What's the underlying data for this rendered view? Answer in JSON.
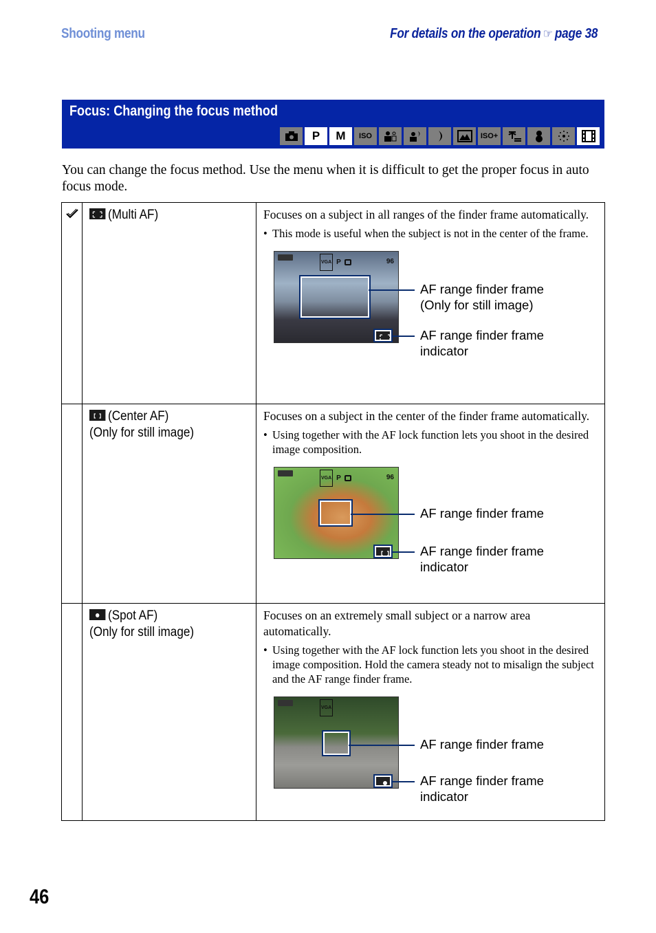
{
  "running_head": {
    "section": "Shooting menu",
    "details_prefix": "For details on the operation",
    "details_icon": "pointing-hand-icon",
    "details_page": "page 38"
  },
  "title_bar": {
    "title": "Focus: Changing the focus method",
    "mode_icons": [
      {
        "name": "auto-camera-icon",
        "label": "",
        "active": false
      },
      {
        "name": "program-mode-icon",
        "label": "P",
        "active": true
      },
      {
        "name": "manual-mode-icon",
        "label": "M",
        "active": true
      },
      {
        "name": "high-sensitivity-icon",
        "label": "ISO",
        "active": false
      },
      {
        "name": "soft-snap-icon",
        "label": "",
        "active": false
      },
      {
        "name": "twilight-portrait-icon",
        "label": "",
        "active": false
      },
      {
        "name": "twilight-icon",
        "label": "",
        "active": false
      },
      {
        "name": "landscape-icon",
        "label": "",
        "active": false
      },
      {
        "name": "high-speed-shutter-iso-plus-icon",
        "label": "ISO+",
        "active": false
      },
      {
        "name": "beach-icon",
        "label": "",
        "active": false
      },
      {
        "name": "snow-icon",
        "label": "",
        "active": false
      },
      {
        "name": "fireworks-icon",
        "label": "",
        "active": false
      },
      {
        "name": "movie-icon",
        "label": "",
        "active": true
      }
    ]
  },
  "intro": "You can change the focus method. Use the menu when it is difficult to get the proper focus in auto focus mode.",
  "rows": [
    {
      "default": true,
      "icon": "multi-af-icon",
      "name": "(Multi AF)",
      "name_note": "",
      "description": "Focuses on a subject in all ranges of the finder frame automatically.",
      "bullet": "This mode is useful when the subject is not in the center of the frame.",
      "image": {
        "scene": "business-people",
        "osd_number": "96",
        "osd_mode": "P",
        "callout_frame": "AF range finder frame",
        "callout_frame_note": "(Only for still image)",
        "callout_indicator": "AF range finder frame indicator"
      }
    },
    {
      "default": false,
      "icon": "center-af-icon",
      "name": "(Center AF)",
      "name_note": "(Only for still image)",
      "description": "Focuses on a subject in the center of the finder frame automatically.",
      "bullet": "Using together with the AF lock function lets you shoot in the desired image composition.",
      "image": {
        "scene": "dog-closeup",
        "osd_number": "96",
        "osd_mode": "P",
        "callout_frame": "AF range finder frame",
        "callout_frame_note": "",
        "callout_indicator": "AF range finder frame indicator"
      }
    },
    {
      "default": false,
      "icon": "spot-af-icon",
      "name": "(Spot AF)",
      "name_note": "(Only for still image)",
      "description": "Focuses on an extremely small subject or a narrow area automatically.",
      "bullet": "Using together with the AF lock function lets you shoot in the desired image composition. Hold the camera steady not to misalign the subject and the AF range finder frame.",
      "image": {
        "scene": "dog-on-steps",
        "osd_number": "",
        "osd_mode": "",
        "callout_frame": "AF range finder frame",
        "callout_frame_note": "",
        "callout_indicator": "AF range finder frame indicator"
      }
    }
  ],
  "page_number": "46",
  "colors": {
    "title_bar": "#0525a6",
    "running_head_section": "#6f8fd6",
    "running_head_details": "#0a239c",
    "mode_icon_inactive": "#7f7f7f",
    "leader_line": "#0a2d6e"
  }
}
